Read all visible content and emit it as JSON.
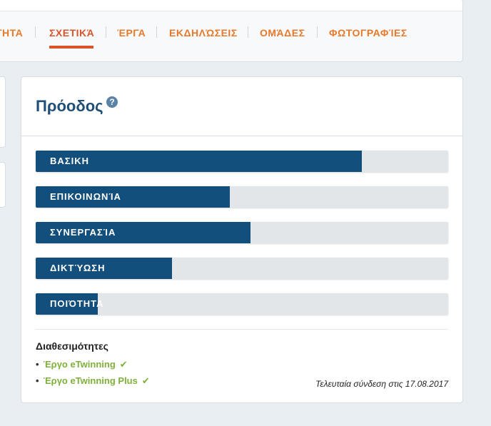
{
  "tabs": [
    {
      "label": "ΤΗΤΑ",
      "active": false
    },
    {
      "label": "ΣΧΕΤΙΚΆ",
      "active": true
    },
    {
      "label": "ΈΡΓΑ",
      "active": false
    },
    {
      "label": "ΕΚΔΗΛΏΣΕΙΣ",
      "active": false
    },
    {
      "label": "ΟΜΆΔΕΣ",
      "active": false
    },
    {
      "label": "ΦΩΤΟΓΡΑΦΊΕΣ",
      "active": false
    }
  ],
  "progress": {
    "title": "Πρόοδος",
    "help_icon": "?",
    "bars": [
      {
        "label": "ΒΑΣΙΚΗ",
        "percent": 79
      },
      {
        "label": "ΕΠΙΚΟΙΝΩΝΊΑ",
        "percent": 47
      },
      {
        "label": "ΣΥΝΕΡΓΑΣΊΑ",
        "percent": 52
      },
      {
        "label": "ΔΙΚΤΎΩΣΗ",
        "percent": 33
      },
      {
        "label": "ΠΟΙΌΤΗΤΑ",
        "percent": 15
      }
    ],
    "availability_title": "Διαθεσιμότητες",
    "availability": [
      {
        "label": "Έργο eTwinning",
        "icon": "check-icon"
      },
      {
        "label": "Έργο eTwinning Plus",
        "icon": "check-icon"
      }
    ],
    "last_login": "Τελευταία σύνδεση στις 17.08.2017"
  },
  "colors": {
    "tab_text": "#e8782a",
    "tab_active": "#d9542b",
    "bar_fill": "#134f7c",
    "bar_track": "#e2e6e9",
    "title": "#1f4f78",
    "availability": "#7fb03a"
  }
}
